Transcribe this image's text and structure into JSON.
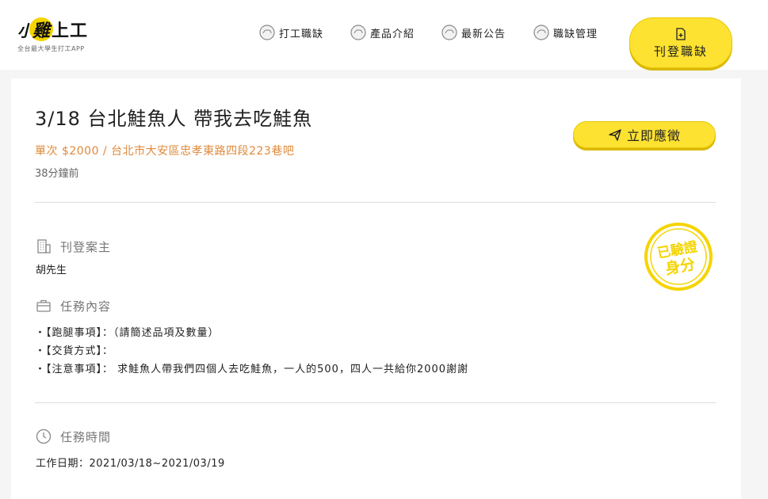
{
  "brand": {
    "logo_small": "小",
    "logo_disc": "雞",
    "logo_rest": "上工",
    "tagline": "全台最大學生打工APP",
    "accent_color": "#fde232"
  },
  "nav": {
    "items": [
      {
        "label": "打工職缺",
        "icon": "cloud-badge-icon"
      },
      {
        "label": "產品介紹",
        "icon": "cloud-badge-icon"
      },
      {
        "label": "最新公告",
        "icon": "cloud-badge-icon"
      },
      {
        "label": "職缺管理",
        "icon": "cloud-badge-icon"
      }
    ],
    "post_button": {
      "label": "刊登職缺",
      "icon": "document-add-icon"
    }
  },
  "job": {
    "title": "3/18 台北鮭魚人 帶我去吃鮭魚",
    "pay_location": "單次 $2000 / 台北市大安區忠孝東路四段223巷吧",
    "posted_ago": "38分鐘前",
    "apply_button": {
      "label": "立即應徵",
      "icon": "send-icon"
    },
    "verified_badge": {
      "line1": "已驗證",
      "line2": "身分",
      "color": "#f5d400"
    }
  },
  "sections": {
    "owner": {
      "heading": "刊登案主",
      "icon": "building-icon",
      "value": "胡先生"
    },
    "task": {
      "heading": "任務內容",
      "icon": "briefcase-icon",
      "items": [
        "・【跑腿事項】：（請簡述品項及數量）",
        "・【交貨方式】：",
        "・【注意事項】： 求鮭魚人帶我們四個人去吃鮭魚，一人的500，四人一共給你2000謝謝"
      ]
    },
    "time": {
      "heading": "任務時間",
      "icon": "clock-icon",
      "date_line": "工作日期：2021/03/18~2021/03/19"
    }
  }
}
